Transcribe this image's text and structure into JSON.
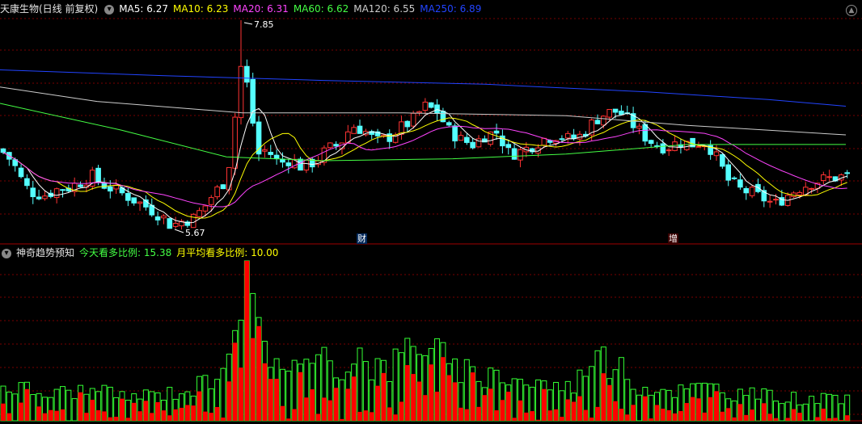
{
  "header": {
    "stock_title": "天康生物(日线 前复权)",
    "ma": [
      {
        "label": "MA5: 6.27",
        "color": "#ffffff"
      },
      {
        "label": "MA10: 6.23",
        "color": "#ffff00"
      },
      {
        "label": "MA20: 6.31",
        "color": "#ff44ff"
      },
      {
        "label": "MA60: 6.62",
        "color": "#44ff44"
      },
      {
        "label": "MA120: 6.55",
        "color": "#cccccc"
      },
      {
        "label": "MA250: 6.89",
        "color": "#2244ff"
      }
    ]
  },
  "lower_header": {
    "indicator_name": "神奇趋势预知",
    "today_label": "今天看多比例: 15.38",
    "today_color": "#44ff44",
    "month_label": "月平均看多比例: 10.00",
    "month_color": "#ffff00"
  },
  "annotations": {
    "high_label": "7.85",
    "low_label": "5.67",
    "marker_cai": "财",
    "marker_zeng": "增"
  },
  "colors": {
    "up": "#ff3333",
    "down": "#54ffff",
    "grid": "#7a0000",
    "bar_red": "#ff0000",
    "bar_green": "#33ff33"
  }
}
